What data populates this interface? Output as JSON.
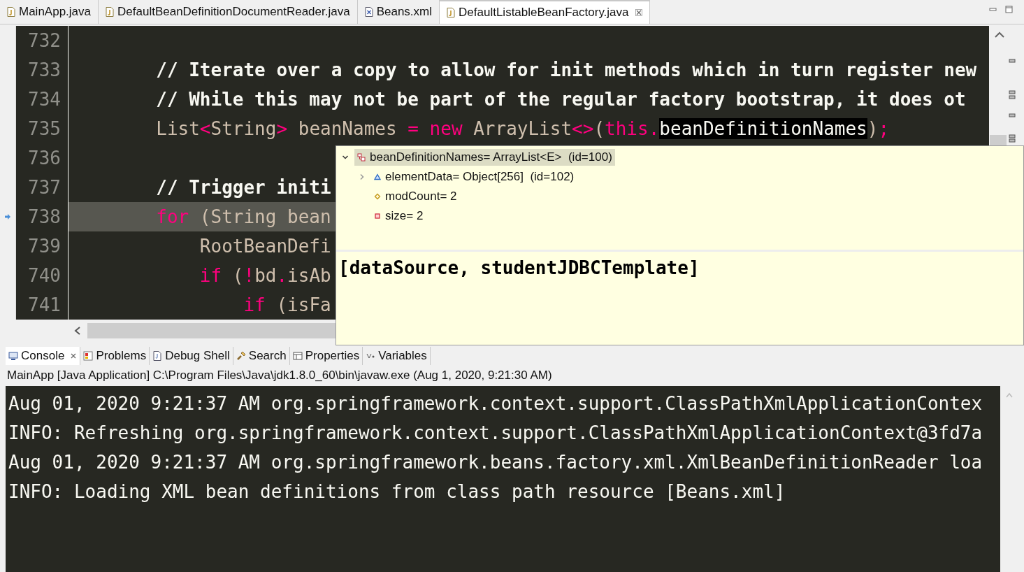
{
  "editor_tabs": [
    {
      "label": "MainApp.java",
      "kind": "java",
      "selected": false
    },
    {
      "label": "DefaultBeanDefinitionDocumentReader.java",
      "kind": "java",
      "selected": false
    },
    {
      "label": "Beans.xml",
      "kind": "xml",
      "selected": false
    },
    {
      "label": "DefaultListableBeanFactory.java",
      "kind": "java",
      "selected": true
    }
  ],
  "editor": {
    "lines": [
      {
        "number": "732",
        "current": false
      },
      {
        "number": "733",
        "current": false,
        "tokens": [
          {
            "text": "        // Iterate over a copy to allow for init methods which in turn register new",
            "kind": "comment"
          }
        ]
      },
      {
        "number": "734",
        "current": false,
        "tokens": [
          {
            "text": "        // While this may not be part of the regular factory bootstrap, it does ot",
            "kind": "comment"
          }
        ]
      },
      {
        "number": "735",
        "current": false,
        "tokens": [
          {
            "text": "        List",
            "kind": "plain"
          },
          {
            "text": "<",
            "kind": "op"
          },
          {
            "text": "String",
            "kind": "plain"
          },
          {
            "text": ">",
            "kind": "op"
          },
          {
            "text": " beanNames ",
            "kind": "plain"
          },
          {
            "text": "=",
            "kind": "op"
          },
          {
            "text": " new",
            "kind": "keyword"
          },
          {
            "text": " ArrayList",
            "kind": "plain"
          },
          {
            "text": "<>",
            "kind": "op"
          },
          {
            "text": "(",
            "kind": "plain"
          },
          {
            "text": "this",
            "kind": "keyword"
          },
          {
            "text": ".",
            "kind": "op"
          },
          {
            "text": "beanDefinitionNames",
            "kind": "highlight"
          },
          {
            "text": ")",
            "kind": "plain"
          },
          {
            "text": ";",
            "kind": "op"
          }
        ]
      },
      {
        "number": "736",
        "current": false
      },
      {
        "number": "737",
        "current": false,
        "tokens": [
          {
            "text": "        // Trigger initi",
            "kind": "comment"
          }
        ]
      },
      {
        "number": "738",
        "current": true,
        "tokens": [
          {
            "text": "        for",
            "kind": "keyword"
          },
          {
            "text": " (String bean",
            "kind": "plain"
          }
        ]
      },
      {
        "number": "739",
        "current": false,
        "tokens": [
          {
            "text": "            RootBeanDefi",
            "kind": "plain"
          }
        ]
      },
      {
        "number": "740",
        "current": false,
        "tokens": [
          {
            "text": "            if",
            "kind": "keyword"
          },
          {
            "text": " (",
            "kind": "plain"
          },
          {
            "text": "!",
            "kind": "op"
          },
          {
            "text": "bd",
            "kind": "plain"
          },
          {
            "text": ".",
            "kind": "op"
          },
          {
            "text": "isAb",
            "kind": "plain"
          }
        ]
      },
      {
        "number": "741",
        "current": false,
        "tokens": [
          {
            "text": "                if",
            "kind": "keyword"
          },
          {
            "text": " (isFa",
            "kind": "plain"
          }
        ]
      }
    ]
  },
  "debug_hover": {
    "variables": [
      {
        "label": "beanDefinitionNames= ArrayList<E>  (id=100)",
        "kind": "object",
        "expanded": true,
        "selected": true,
        "children": [
          {
            "label": "elementData= Object[256]  (id=102)",
            "kind": "protected",
            "expanded": false,
            "selected": false
          },
          {
            "label": "modCount= 2",
            "kind": "package",
            "selected": false
          },
          {
            "label": "size= 2",
            "kind": "private",
            "selected": false
          }
        ]
      }
    ],
    "detail": "[dataSource, studentJDBCTemplate]"
  },
  "bottom_tabs": [
    {
      "label": "Console",
      "kind": "console",
      "selected": true
    },
    {
      "label": "Problems",
      "kind": "problems",
      "selected": false
    },
    {
      "label": "Debug Shell",
      "kind": "debug-shell",
      "selected": false
    },
    {
      "label": "Search",
      "kind": "search",
      "selected": false
    },
    {
      "label": "Properties",
      "kind": "properties",
      "selected": false
    },
    {
      "label": "Variables",
      "kind": "variables",
      "selected": false
    }
  ],
  "console": {
    "launch_label": "MainApp [Java Application] C:\\Program Files\\Java\\jdk1.8.0_60\\bin\\javaw.exe (Aug 1, 2020, 9:21:30 AM)",
    "lines": [
      "Aug 01, 2020 9:21:37 AM org.springframework.context.support.ClassPathXmlApplicationContex",
      "INFO: Refreshing org.springframework.context.support.ClassPathXmlApplicationContext@3fd7a",
      "Aug 01, 2020 9:21:37 AM org.springframework.beans.factory.xml.XmlBeanDefinitionReader loa",
      "INFO: Loading XML bean definitions from class path resource [Beans.xml]"
    ]
  }
}
